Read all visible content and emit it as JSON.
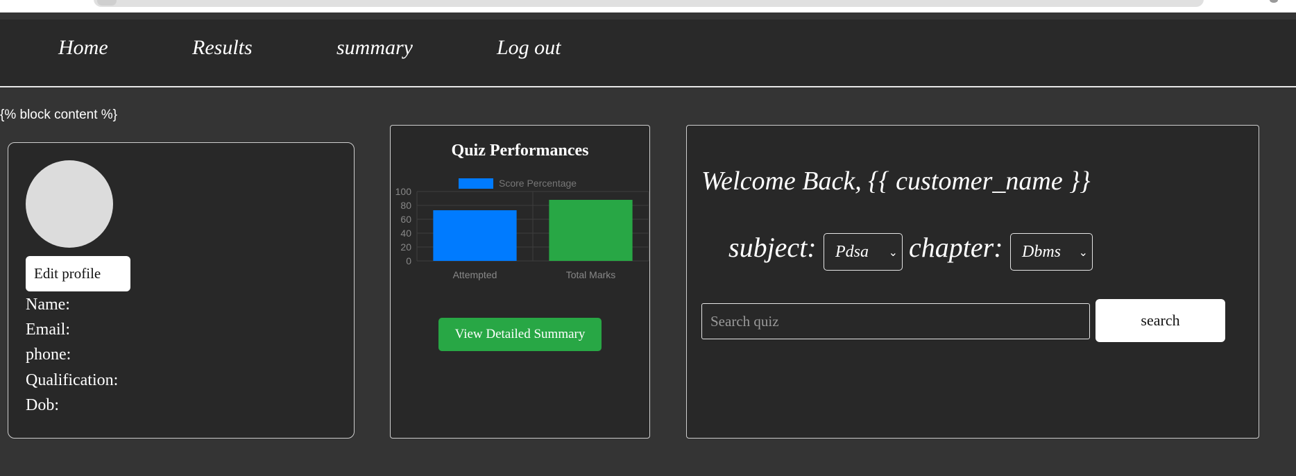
{
  "nav": {
    "items": [
      {
        "label": "Home"
      },
      {
        "label": "Results"
      },
      {
        "label": "summary"
      },
      {
        "label": "Log out"
      }
    ]
  },
  "template_text": "{% block content %}",
  "profile": {
    "edit_label": "Edit profile",
    "fields": [
      "Name:",
      "Email:",
      "phone:",
      "Qualification:",
      "Dob:"
    ]
  },
  "quiz_panel": {
    "title": "Quiz Performances",
    "button_label": "View Detailed Summary"
  },
  "chart_data": {
    "type": "bar",
    "categories": [
      "Attempted",
      "Total Marks"
    ],
    "series": [
      {
        "name": "Score Percentage",
        "values": [
          73,
          88
        ]
      }
    ],
    "bar_colors": [
      "#007bff",
      "#28a745"
    ],
    "ylim": [
      0,
      100
    ],
    "yticks": [
      0,
      20,
      40,
      60,
      80,
      100
    ],
    "grid": true,
    "legend": "top"
  },
  "welcome": {
    "greeting": "Welcome Back, {{ customer_name }}",
    "subject_label": "subject:",
    "subject_value": "Pdsa",
    "chapter_label": "chapter:",
    "chapter_value": "Dbms",
    "search_placeholder": "Search quiz",
    "search_button": "search"
  },
  "colors": {
    "background": "#343434",
    "panel": "#282828",
    "accent_blue": "#007bff",
    "accent_green": "#28a745"
  }
}
